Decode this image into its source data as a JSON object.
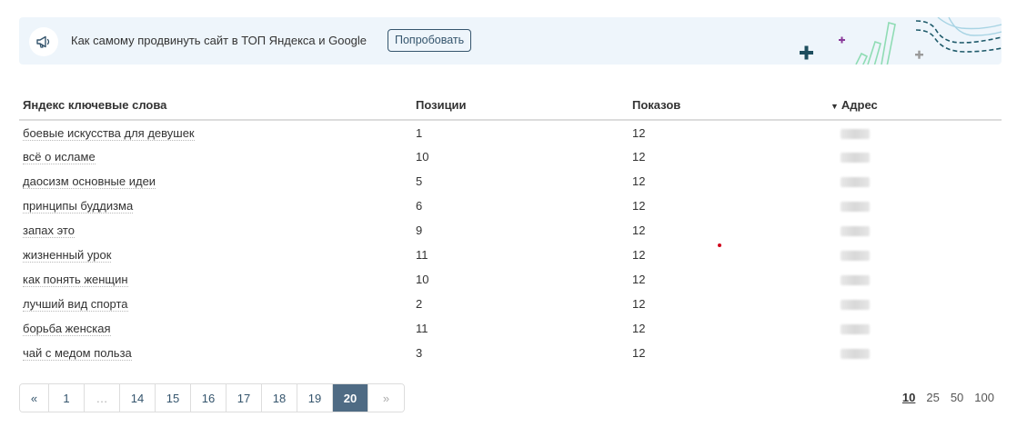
{
  "promo": {
    "text": "Как самому продвинуть сайт в ТОП Яндекса и Google",
    "button_label": "Попробовать"
  },
  "table": {
    "headers": {
      "keyword": "Яндекс ключевые слова",
      "position": "Позиции",
      "shows": "Показов",
      "address": "Адрес"
    },
    "sorted_column": "address",
    "rows": [
      {
        "keyword": "боевые искусства для девушек",
        "position": "1",
        "shows": "12"
      },
      {
        "keyword": "всё о исламе",
        "position": "10",
        "shows": "12"
      },
      {
        "keyword": "даосизм основные идеи",
        "position": "5",
        "shows": "12"
      },
      {
        "keyword": "принципы буддизма",
        "position": "6",
        "shows": "12"
      },
      {
        "keyword": "запах это",
        "position": "9",
        "shows": "12"
      },
      {
        "keyword": "жизненный урок",
        "position": "11",
        "shows": "12"
      },
      {
        "keyword": "как понять женщин",
        "position": "10",
        "shows": "12"
      },
      {
        "keyword": "лучший вид спорта",
        "position": "2",
        "shows": "12"
      },
      {
        "keyword": "борьба женская",
        "position": "11",
        "shows": "12"
      },
      {
        "keyword": "чай с медом польза",
        "position": "3",
        "shows": "12"
      }
    ]
  },
  "pagination": {
    "prev": "«",
    "first": "1",
    "ellipsis": "…",
    "pages": [
      "14",
      "15",
      "16",
      "17",
      "18",
      "19",
      "20"
    ],
    "current": "20",
    "next": "»"
  },
  "per_page": {
    "options": [
      "10",
      "25",
      "50",
      "100"
    ],
    "current": "10"
  },
  "colors": {
    "accent": "#35556d",
    "active_page_bg": "#4f6b84",
    "promo_bg": "#eef5fb"
  },
  "icons": {
    "promo": "megaphone-icon",
    "sort": "caret-down-icon"
  }
}
